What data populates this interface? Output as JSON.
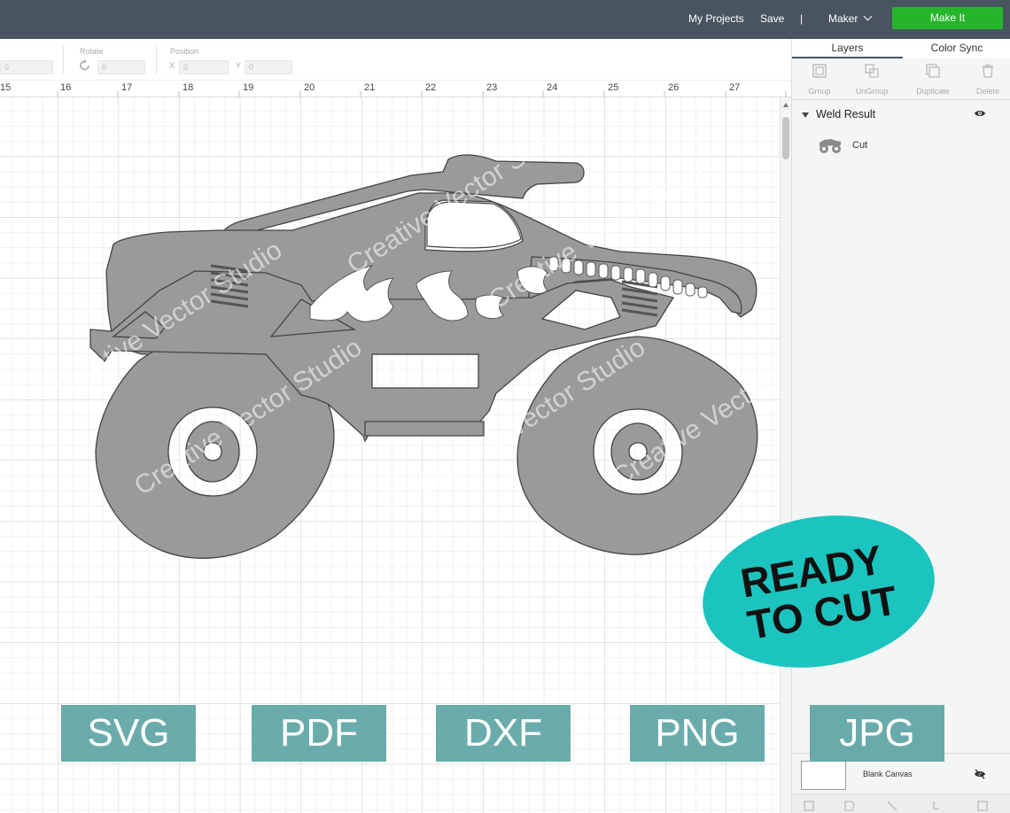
{
  "header": {
    "my_projects": "My Projects",
    "save": "Save",
    "separator": "|",
    "machine": "Maker",
    "make_it": "Make It",
    "colors": {
      "bar": "#485560",
      "make_it": "#25b52a"
    }
  },
  "toolbar": {
    "rotate_label": "Rotate",
    "rotate_value": "0",
    "position_label": "Position",
    "x_label": "X",
    "x_value": "0",
    "y_label": "Y",
    "y_value": "0",
    "size_value": "0"
  },
  "ruler": {
    "ticks": [
      "15",
      "16",
      "17",
      "18",
      "19",
      "20",
      "21",
      "22",
      "23",
      "24",
      "25",
      "26",
      "27"
    ]
  },
  "panel": {
    "tabs": [
      "Layers",
      "Color Sync"
    ],
    "tools": [
      {
        "label": "Group",
        "icon": "group-icon"
      },
      {
        "label": "UnGroup",
        "icon": "ungroup-icon"
      },
      {
        "label": "Duplicate",
        "icon": "duplicate-icon"
      },
      {
        "label": "Delete",
        "icon": "delete-icon"
      }
    ],
    "group_name": "Weld Result",
    "layer_name": "Cut",
    "blank_canvas": "Blank Canvas"
  },
  "canvas": {
    "watermark": "Creative Vector Studio",
    "design": "monster-truck",
    "fill_color": "#9a9a9a"
  },
  "promo": {
    "ready_line1": "READY",
    "ready_line2": "TO CUT",
    "ready_color": "#1cc4bf",
    "formats": [
      "SVG",
      "PDF",
      "DXF",
      "PNG",
      "JPG"
    ],
    "format_color": "#5fa6a6"
  }
}
